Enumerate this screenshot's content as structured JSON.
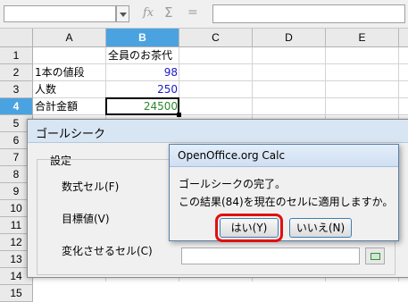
{
  "toolbar": {
    "fx_label": "𝑓x",
    "sigma_label": "Σ",
    "equals_label": "="
  },
  "sheet": {
    "columns": [
      "A",
      "B",
      "C",
      "D",
      "E"
    ],
    "selected_column": "B",
    "rows": [
      "1",
      "2",
      "3",
      "4",
      "5",
      "6",
      "7",
      "8",
      "9",
      "10",
      "11",
      "12",
      "13",
      "14",
      "15"
    ],
    "selected_row": "4",
    "cells": {
      "B1": "全員のお茶代",
      "A2": "1本の値段",
      "B2": "98",
      "A3": "人数",
      "B3": "250",
      "A4": "合計金額",
      "B4": "24500"
    },
    "colors": {
      "header_selected": "#4aa3e0",
      "number_blue": "#1a1ac8",
      "number_green": "#2a8a2a"
    }
  },
  "goal_seek": {
    "title": "ゴールシーク",
    "group_label": "設定",
    "formula_cell_label": "数式セル(F)",
    "target_value_label": "目標値(V)",
    "variable_cell_label": "変化させるセル(C)"
  },
  "message_box": {
    "title": "OpenOffice.org Calc",
    "line1": "ゴールシークの完了。",
    "line2": "この結果(84)を現在のセルに適用しますか。",
    "yes_label": "はい(Y)",
    "no_label": "いいえ(N)",
    "highlight_color": "#e01010"
  }
}
